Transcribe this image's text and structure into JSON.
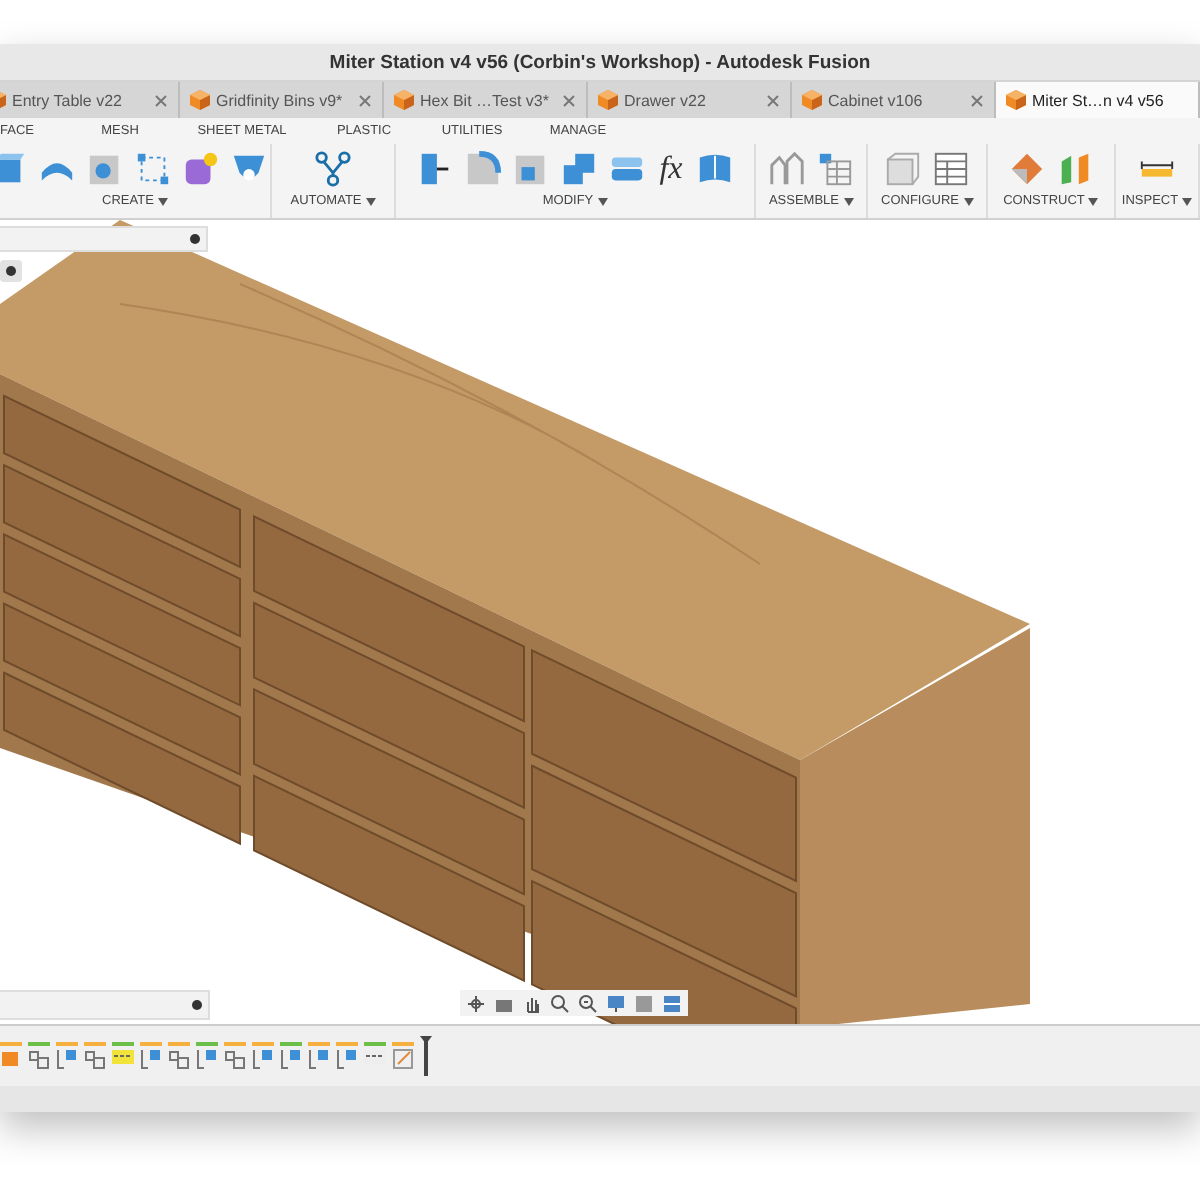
{
  "window": {
    "title": "Miter Station v4 v56 (Corbin's Workshop) - Autodesk Fusion"
  },
  "tabs": [
    {
      "label": "Entry Table v22",
      "selected": false
    },
    {
      "label": "Gridfinity Bins v9*",
      "selected": false
    },
    {
      "label": "Hex Bit …Test v3*",
      "selected": false
    },
    {
      "label": "Drawer v22",
      "selected": false
    },
    {
      "label": "Cabinet v106",
      "selected": false
    },
    {
      "label": "Miter St…n v4 v56",
      "selected": true
    }
  ],
  "toolbar_tabs": [
    {
      "label": "FACE"
    },
    {
      "label": "MESH"
    },
    {
      "label": "SHEET METAL"
    },
    {
      "label": "PLASTIC"
    },
    {
      "label": "UTILITIES"
    },
    {
      "label": "MANAGE"
    }
  ],
  "toolbar_groups": [
    {
      "label": "CREATE",
      "kind": "create"
    },
    {
      "label": "AUTOMATE",
      "kind": "automate"
    },
    {
      "label": "MODIFY",
      "kind": "modify",
      "icon_text": "fx"
    },
    {
      "label": "ASSEMBLE",
      "kind": "assemble"
    },
    {
      "label": "CONFIGURE",
      "kind": "configure"
    },
    {
      "label": "CONSTRUCT",
      "kind": "construct"
    },
    {
      "label": "INSPECT",
      "kind": "inspect"
    }
  ]
}
